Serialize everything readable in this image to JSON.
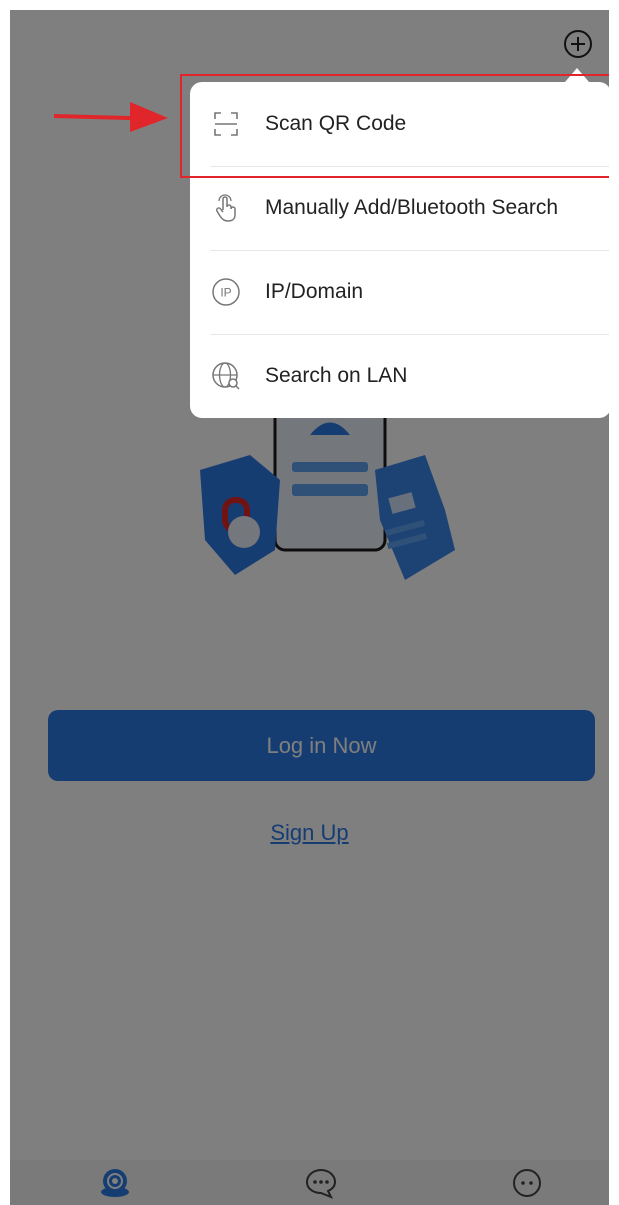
{
  "main": {
    "login_label": "Log in Now",
    "signup_label": "Sign Up"
  },
  "menu": {
    "items": [
      {
        "label": "Scan QR Code",
        "icon": "scan-icon"
      },
      {
        "label": "Manually Add/Bluetooth Search",
        "icon": "touch-icon"
      },
      {
        "label": "IP/Domain",
        "icon": "ip-icon"
      },
      {
        "label": "Search on LAN",
        "icon": "globe-search-icon"
      }
    ]
  },
  "colors": {
    "accent": "#2c7be5",
    "highlight": "#e0262b"
  },
  "tabbar": {
    "items": [
      {
        "icon": "device-icon"
      },
      {
        "icon": "message-icon"
      },
      {
        "icon": "more-icon"
      }
    ]
  }
}
